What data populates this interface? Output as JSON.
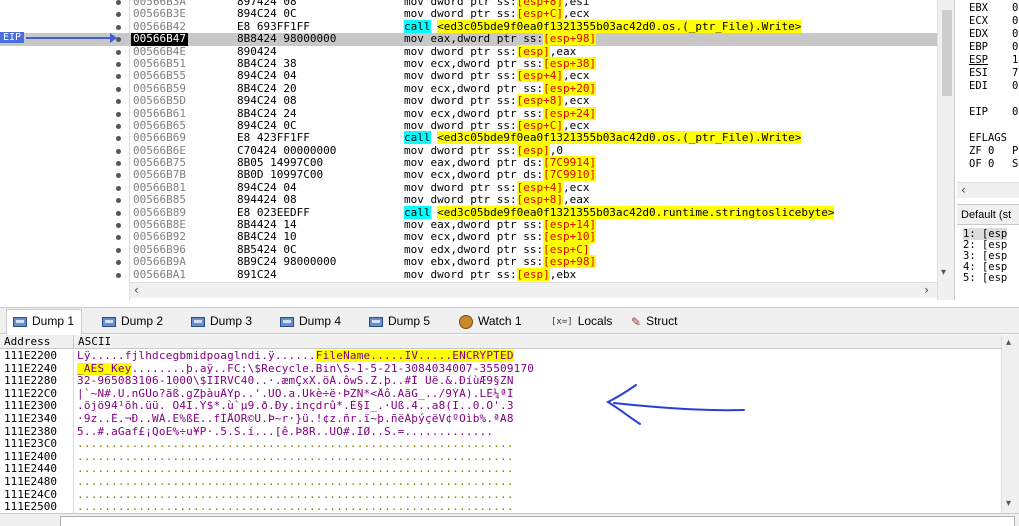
{
  "disasm": {
    "eip_label": "EIP",
    "rows": [
      {
        "addr": "00566B3A",
        "bytes": "897424 08",
        "instr": [
          {
            "t": "mov dword ptr ss:"
          },
          {
            "t": "[esp+8]",
            "c": "op"
          },
          {
            "t": ",esi"
          }
        ]
      },
      {
        "addr": "00566B3E",
        "bytes": "894C24 0C",
        "instr": [
          {
            "t": "mov dword ptr ss:"
          },
          {
            "t": "[esp+C]",
            "c": "op"
          },
          {
            "t": ",ecx"
          }
        ]
      },
      {
        "addr": "00566B42",
        "bytes": "E8 693FF1FF",
        "instr": [
          {
            "t": "call",
            "c": "call"
          },
          {
            "t": " "
          },
          {
            "t": "<ed3c05bde9f0ea0f1321355b03ac42d0.os.(_ptr_File).Write>",
            "c": "target"
          }
        ]
      },
      {
        "addr": "00566B47",
        "bytes": "8B8424 98000000",
        "current": true,
        "instr": [
          {
            "t": "mov eax,dword ptr ss:"
          },
          {
            "t": "[esp+98]",
            "c": "op"
          }
        ]
      },
      {
        "addr": "00566B4E",
        "bytes": "890424",
        "instr": [
          {
            "t": "mov dword ptr ss:"
          },
          {
            "t": "[esp]",
            "c": "op"
          },
          {
            "t": ",eax"
          }
        ]
      },
      {
        "addr": "00566B51",
        "bytes": "8B4C24 38",
        "instr": [
          {
            "t": "mov ecx,dword ptr ss:"
          },
          {
            "t": "[esp+38]",
            "c": "op"
          }
        ]
      },
      {
        "addr": "00566B55",
        "bytes": "894C24 04",
        "instr": [
          {
            "t": "mov dword ptr ss:"
          },
          {
            "t": "[esp+4]",
            "c": "op"
          },
          {
            "t": ",ecx"
          }
        ]
      },
      {
        "addr": "00566B59",
        "bytes": "8B4C24 20",
        "instr": [
          {
            "t": "mov ecx,dword ptr ss:"
          },
          {
            "t": "[esp+20]",
            "c": "op"
          }
        ]
      },
      {
        "addr": "00566B5D",
        "bytes": "894C24 08",
        "instr": [
          {
            "t": "mov dword ptr ss:"
          },
          {
            "t": "[esp+8]",
            "c": "op"
          },
          {
            "t": ",ecx"
          }
        ]
      },
      {
        "addr": "00566B61",
        "bytes": "8B4C24 24",
        "instr": [
          {
            "t": "mov ecx,dword ptr ss:"
          },
          {
            "t": "[esp+24]",
            "c": "op"
          }
        ]
      },
      {
        "addr": "00566B65",
        "bytes": "894C24 0C",
        "instr": [
          {
            "t": "mov dword ptr ss:"
          },
          {
            "t": "[esp+C]",
            "c": "op"
          },
          {
            "t": ",ecx"
          }
        ]
      },
      {
        "addr": "00566B69",
        "bytes": "E8 423FF1FF",
        "instr": [
          {
            "t": "call",
            "c": "call"
          },
          {
            "t": " "
          },
          {
            "t": "<ed3c05bde9f0ea0f1321355b03ac42d0.os.(_ptr_File).Write>",
            "c": "target"
          }
        ]
      },
      {
        "addr": "00566B6E",
        "bytes": "C70424 00000000",
        "instr": [
          {
            "t": "mov dword ptr ss:"
          },
          {
            "t": "[esp]",
            "c": "op"
          },
          {
            "t": ",0"
          }
        ]
      },
      {
        "addr": "00566B75",
        "bytes": "8B05 14997C00",
        "instr": [
          {
            "t": "mov eax,dword ptr ds:"
          },
          {
            "t": "[7C9914]",
            "c": "mem"
          }
        ]
      },
      {
        "addr": "00566B7B",
        "bytes": "8B0D 10997C00",
        "instr": [
          {
            "t": "mov ecx,dword ptr ds:"
          },
          {
            "t": "[7C9910]",
            "c": "mem"
          }
        ]
      },
      {
        "addr": "00566B81",
        "bytes": "894C24 04",
        "instr": [
          {
            "t": "mov dword ptr ss:"
          },
          {
            "t": "[esp+4]",
            "c": "op"
          },
          {
            "t": ",ecx"
          }
        ]
      },
      {
        "addr": "00566B85",
        "bytes": "894424 08",
        "instr": [
          {
            "t": "mov dword ptr ss:"
          },
          {
            "t": "[esp+8]",
            "c": "op"
          },
          {
            "t": ",eax"
          }
        ]
      },
      {
        "addr": "00566B89",
        "bytes": "E8 023EEDFF",
        "instr": [
          {
            "t": "call",
            "c": "call"
          },
          {
            "t": " "
          },
          {
            "t": "<ed3c05bde9f0ea0f1321355b03ac42d0.runtime.stringtoslicebyte>",
            "c": "target"
          }
        ]
      },
      {
        "addr": "00566B8E",
        "bytes": "8B4424 14",
        "instr": [
          {
            "t": "mov eax,dword ptr ss:"
          },
          {
            "t": "[esp+14]",
            "c": "op"
          }
        ]
      },
      {
        "addr": "00566B92",
        "bytes": "8B4C24 10",
        "instr": [
          {
            "t": "mov ecx,dword ptr ss:"
          },
          {
            "t": "[esp+10]",
            "c": "op"
          }
        ]
      },
      {
        "addr": "00566B96",
        "bytes": "8B5424 0C",
        "instr": [
          {
            "t": "mov edx,dword ptr ss:"
          },
          {
            "t": "[esp+C]",
            "c": "op"
          }
        ]
      },
      {
        "addr": "00566B9A",
        "bytes": "8B9C24 98000000",
        "instr": [
          {
            "t": "mov ebx,dword ptr ss:"
          },
          {
            "t": "[esp+98]",
            "c": "op"
          }
        ]
      },
      {
        "addr": "00566BA1",
        "bytes": "891C24",
        "instr": [
          {
            "t": "mov dword ptr ss:"
          },
          {
            "t": "[esp]",
            "c": "op"
          },
          {
            "t": ",ebx"
          }
        ]
      }
    ]
  },
  "registers": {
    "items": [
      {
        "name": "EBX",
        "value": "0"
      },
      {
        "name": "ECX",
        "value": "0"
      },
      {
        "name": "EDX",
        "value": "0"
      },
      {
        "name": "EBP",
        "value": "0"
      },
      {
        "name": "ESP",
        "value": "1"
      },
      {
        "name": "ESI",
        "value": "7"
      },
      {
        "name": "EDI",
        "value": "0"
      },
      {
        "name": "EIP",
        "value": "0"
      },
      {
        "name": "EFLAGS",
        "value": ""
      },
      {
        "name": "ZF 0",
        "value": "P"
      },
      {
        "name": "OF 0",
        "value": "S"
      }
    ]
  },
  "stack_args": {
    "header": "Default (st",
    "items": [
      "1: [esp",
      "2: [esp",
      "3: [esp",
      "4: [esp",
      "5: [esp"
    ]
  },
  "tabs": [
    {
      "label": "Dump 1",
      "active": true,
      "icon": "memory-dump-icon"
    },
    {
      "label": "Dump 2",
      "icon": "memory-dump-icon"
    },
    {
      "label": "Dump 3",
      "icon": "memory-dump-icon"
    },
    {
      "label": "Dump 4",
      "icon": "memory-dump-icon"
    },
    {
      "label": "Dump 5",
      "icon": "memory-dump-icon"
    },
    {
      "label": "Watch 1",
      "icon": "watch-icon"
    },
    {
      "label": "Locals",
      "icon": "locals-icon",
      "icon_text": "[x=]"
    },
    {
      "label": "Struct",
      "icon": "struct-icon"
    }
  ],
  "dump": {
    "header_address": "Address",
    "header_ascii": "ASCII",
    "rows": [
      {
        "addr": "111E2200",
        "ascii": [
          {
            "t": "Lÿ.....fjlhdcegbmidpoaglndi.ÿ......"
          },
          {
            "t": "FileName.....IV.....ENCRYPTED",
            "c": "y"
          }
        ]
      },
      {
        "addr": "111E2240",
        "ascii": [
          {
            "t": "_AES_Key",
            "c": "y"
          },
          {
            "t": "........þ.aÿ..FC:\\$Recycle.Bin\\S-1-5-21-3084034007-35509170"
          }
        ]
      },
      {
        "addr": "111E2280",
        "ascii": [
          {
            "t": "32-965083106-1000\\$IIRVC40..·.æmÇxX.öÀ.ôwS.Z.þ..#Î Ûë.&.ÐíùÆ9§ZN"
          }
        ]
      },
      {
        "addr": "111E22C0",
        "ascii": [
          {
            "t": "|`~Ñ#.U.nGÛo?ãß.gZþàuÄYp..'.UÖ.a.Ûkè÷ë·ÞZÑ*<Äô.AãG_../9ÝÀ).LÉ¼ªÍ"
          }
        ]
      },
      {
        "addr": "111E2300",
        "ascii": [
          {
            "t": ".õjö94¹õh.üü. Ö4I.Ý$*.ù`µ9.ð.Ðy.inçdrû*.È§I_.·Uß.4..a8(I..0.Ö'.3"
          }
        ]
      },
      {
        "addr": "111E2340",
        "ascii": [
          {
            "t": "·9z..È.¬Ð..WÀ.E%ßÉ..fÌÅÕR©U.Þ~r·}ü.!¢z.ñr.ï~þ.ñëÀþýçëV¢ºÖìb%.ªA8"
          }
        ]
      },
      {
        "addr": "111E2380",
        "ascii": [
          {
            "t": "5..#.aGaf£¡QoE%÷u¥P·.5.S.í...[ê.Þ8R..ÜÓ#.ÌØ..S.=............."
          }
        ]
      },
      {
        "addr": "111E23C0",
        "ascii": [
          {
            "t": "................................................................",
            "c": "g"
          }
        ]
      },
      {
        "addr": "111E2400",
        "ascii": [
          {
            "t": "................................................................",
            "c": "g"
          }
        ]
      },
      {
        "addr": "111E2440",
        "ascii": [
          {
            "t": "................................................................",
            "c": "g"
          }
        ]
      },
      {
        "addr": "111E2480",
        "ascii": [
          {
            "t": "................................................................",
            "c": "g"
          }
        ]
      },
      {
        "addr": "111E24C0",
        "ascii": [
          {
            "t": "................................................................",
            "c": "g"
          }
        ]
      },
      {
        "addr": "111E2500",
        "ascii": [
          {
            "t": "................................................................",
            "c": "g"
          }
        ]
      }
    ]
  },
  "colors": {
    "highlight_yellow": "#ffff00",
    "highlight_cyan": "#00ffff",
    "operand_red": "#e00000",
    "ascii_purple": "#800080",
    "eip_blue": "#3d5fd8",
    "current_row_gray": "#c8c8c8"
  }
}
